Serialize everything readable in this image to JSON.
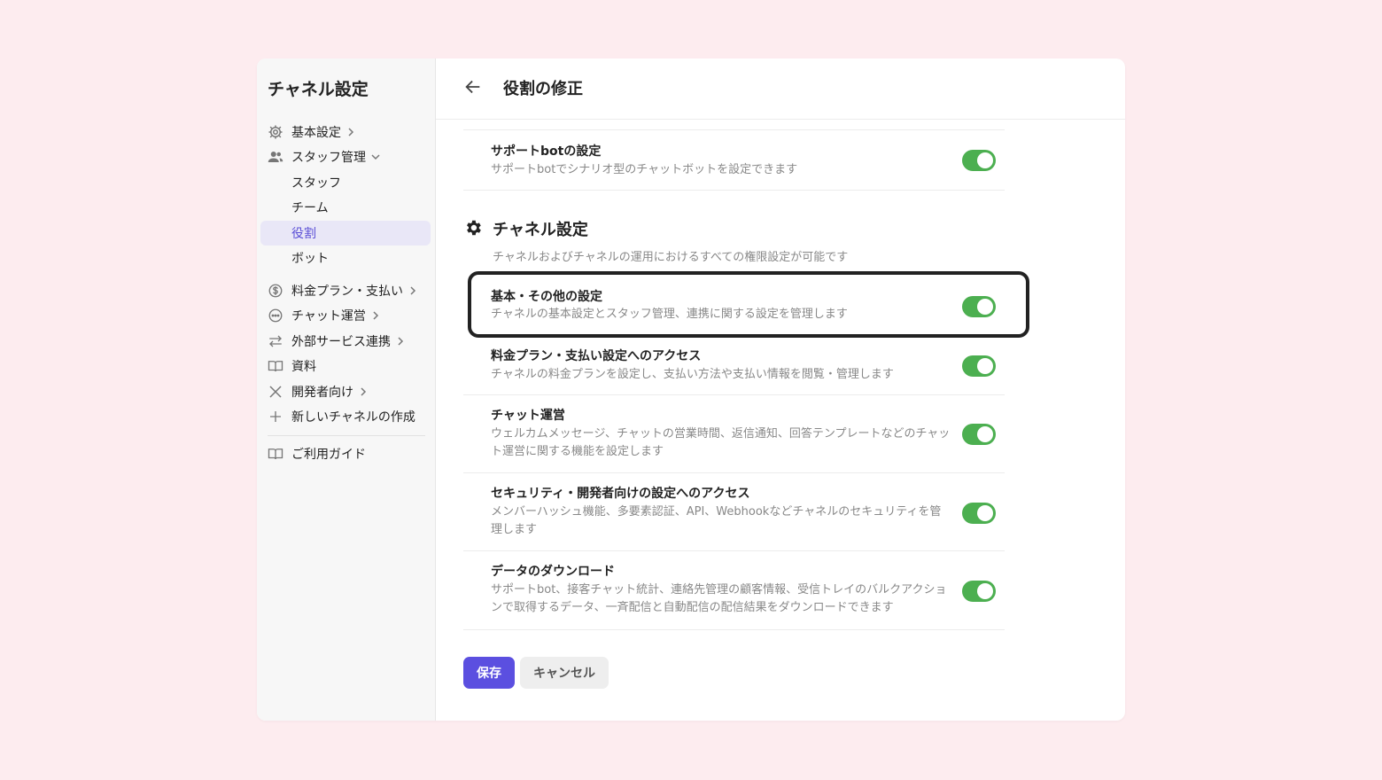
{
  "sidebar": {
    "title": "チャネル設定",
    "items": [
      {
        "label": "基本設定"
      },
      {
        "label": "スタッフ管理"
      },
      {
        "label": "スタッフ"
      },
      {
        "label": "チーム"
      },
      {
        "label": "役割"
      },
      {
        "label": "ボット"
      },
      {
        "label": "料金プラン・支払い"
      },
      {
        "label": "チャット運営"
      },
      {
        "label": "外部サービス連携"
      },
      {
        "label": "資料"
      },
      {
        "label": "開発者向け"
      },
      {
        "label": "新しいチャネルの作成"
      },
      {
        "label": "ご利用ガイド"
      }
    ]
  },
  "header": {
    "title": "役割の修正"
  },
  "rows": [
    {
      "title": "サポートbotの設定",
      "desc": "サポートbotでシナリオ型のチャットボットを設定できます"
    },
    {
      "title": "基本・その他の設定",
      "desc": "チャネルの基本設定とスタッフ管理、連携に関する設定を管理します"
    },
    {
      "title": "料金プラン・支払い設定へのアクセス",
      "desc": "チャネルの料金プランを設定し、支払い方法や支払い情報を閲覧・管理します"
    },
    {
      "title": "チャット運営",
      "desc": "ウェルカムメッセージ、チャットの営業時間、返信通知、回答テンプレートなどのチャット運営に関する機能を設定します"
    },
    {
      "title": "セキュリティ・開発者向けの設定へのアクセス",
      "desc": "メンバーハッシュ機能、多要素認証、API、Webhookなどチャネルのセキュリティを管理します"
    },
    {
      "title": "データのダウンロード",
      "desc": "サポートbot、接客チャット統計、連絡先管理の顧客情報、受信トレイのバルクアクションで取得するデータ、一斉配信と自動配信の配信結果をダウンロードできます"
    }
  ],
  "section": {
    "title": "チャネル設定",
    "desc": "チャネルおよびチャネルの運用におけるすべての権限設定が可能です"
  },
  "buttons": {
    "save": "保存",
    "cancel": "キャンセル"
  },
  "colors": {
    "accent": "#5b4fe0",
    "toggle_on": "#4caf50",
    "background": "#fdecef"
  }
}
